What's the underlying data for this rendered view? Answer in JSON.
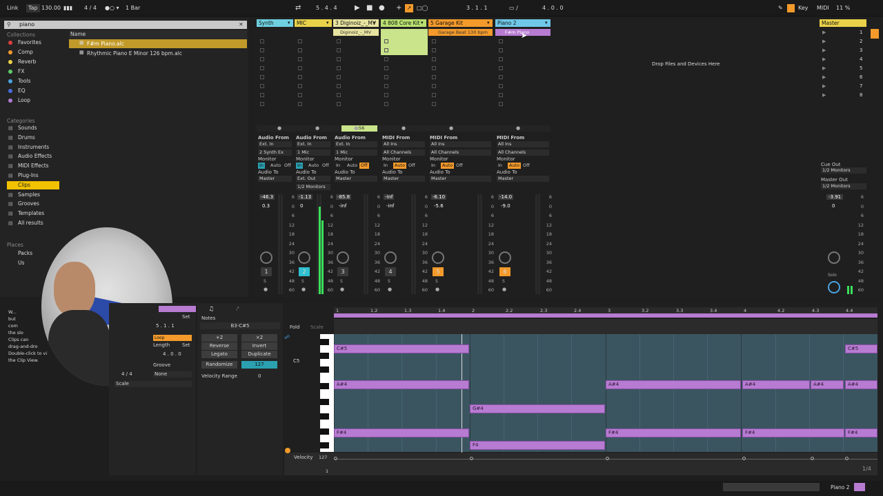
{
  "transport": {
    "link": "Link",
    "tap": "Tap",
    "bpm": "130.00",
    "signature": "4 / 4",
    "quant": "1 Bar",
    "position": "5 . 4 . 4",
    "loop_start": "3 . 1 . 1",
    "loop_len": "4 . 0 . 0",
    "key": "Key",
    "midi": "MIDI",
    "cpu": "11 %"
  },
  "browser": {
    "search_value": "piano",
    "collections_label": "Collections",
    "collections": [
      {
        "label": "Favorites",
        "color": "#e04040"
      },
      {
        "label": "Comp",
        "color": "#f39a2b"
      },
      {
        "label": "Reverb",
        "color": "#e9d24a"
      },
      {
        "label": "FX",
        "color": "#5fc96a"
      },
      {
        "label": "Tools",
        "color": "#4aa3e0"
      },
      {
        "label": "EQ",
        "color": "#4a6ee0"
      },
      {
        "label": "Loop",
        "color": "#b07bd1"
      }
    ],
    "categories_label": "Categories",
    "categories": [
      "Sounds",
      "Drums",
      "Instruments",
      "Audio Effects",
      "MIDI Effects",
      "Plug-Ins",
      "Clips",
      "Samples",
      "Grooves",
      "Templates",
      "All results"
    ],
    "places_label": "Places",
    "places": [
      "Packs",
      "Us",
      "",
      "",
      ""
    ],
    "name_header": "Name",
    "files": [
      "F#m Piano.alc",
      "Rhythmic Piano E Minor 126 bpm.alc"
    ],
    "info_text": [
      "W...",
      "but",
      "com",
      "the slo",
      "Clips can",
      "drag-and-dro",
      "Double-click to vi",
      "the Clip View."
    ]
  },
  "tracks": [
    {
      "name": "Synth",
      "color": "#6fd0e0",
      "from": "Audio From",
      "in": "Ext. In",
      "chan": "2 Synth Ex",
      "to": "Master",
      "vol": "-46.3",
      "pan": "0.3",
      "num": "1",
      "numcolor": "#3a3a3a"
    },
    {
      "name": "MIC",
      "color": "#e9d24a",
      "from": "Audio From",
      "in": "Ext. In",
      "chan": "1 Mic",
      "to": "Ext. Out",
      "to2": "1/2 Monitors",
      "vol": "-1.13",
      "pan": "0",
      "num": "2",
      "numcolor": "#2fbfd0"
    },
    {
      "name": "3 Diginoiz_-_MV",
      "color": "#e8e3a0",
      "from": "Audio From",
      "in": "Ext. In",
      "chan": "1 Mic",
      "to": "Master",
      "vol": "-85.8",
      "pan": "-inf",
      "num": "3",
      "numcolor": "#3a3a3a"
    },
    {
      "name": "4 808 Core Kit",
      "color": "#b8e070",
      "from": "MIDI From",
      "in": "All Ins",
      "chan": "All Channels",
      "to": "Master",
      "vol": "-inf",
      "pan": "-inf",
      "num": "4",
      "numcolor": "#3a3a3a"
    },
    {
      "name": "5 Garage Kit",
      "color": "#f39a2b",
      "from": "MIDI From",
      "in": "All Ins",
      "chan": "All Channels",
      "to": "Master",
      "vol": "-6.10",
      "pan": "-5.6",
      "num": "5",
      "numcolor": "#f39a2b"
    },
    {
      "name": "Piano 2",
      "color": "#70c8e8",
      "from": "MIDI From",
      "in": "All Ins",
      "chan": "All Channels",
      "to": "Master",
      "vol": "-14.0",
      "pan": "-9.0",
      "num": "6",
      "numcolor": "#f39a2b"
    }
  ],
  "clips": {
    "diginoiz": "Diginoiz_-_MV",
    "garage": "Garage Beat 130 bpm",
    "fm_piano": "F#m Piano"
  },
  "audio_from": "Audio From",
  "monitor": "Monitor",
  "audio_to": "Audio To",
  "mon_in": "In",
  "mon_auto": "Auto",
  "mon_off": "Off",
  "drop_text": "Drop Files and Devices Here",
  "master": {
    "name": "Master",
    "cue_out": "Cue Out",
    "cue_val": "1/2 Monitors",
    "master_out": "Master Out",
    "master_val": "1/2 Monitors",
    "vol": "-3.91",
    "pan": "0",
    "solo": "Solo"
  },
  "scenes": [
    "1",
    "2",
    "3",
    "4",
    "5",
    "6",
    "7",
    "8"
  ],
  "meter_scale": [
    "6",
    "0",
    "6",
    "12",
    "18",
    "24",
    "30",
    "36",
    "42",
    "48",
    "60"
  ],
  "clipview": {
    "set1": "Set",
    "set2": "Set",
    "sig": "5 . 1 . 1",
    "length_lbl": "Length",
    "len_val": "4 . 0 . 0",
    "groove": "Groove",
    "none": "None",
    "scale": "Scale",
    "sig2": "4 / 4",
    "loop": "Loop",
    "notes_lbl": "Notes",
    "range": "B3-C#5",
    "fold": "Fold",
    "scale2": "Scale",
    "plus2": "+2",
    "x2": "×2",
    "reverse": "Reverse",
    "invert": "Invert",
    "legato": "Legato",
    "duplicate": "Duplicate",
    "randomize": "Randomize",
    "rand_val": "127",
    "vel_range": "Velocity Range",
    "vel_range_val": "0",
    "velocity": "Velocity",
    "vel_max": "127",
    "vel_min": "1",
    "pitch": "C5",
    "page": "1/4"
  },
  "ruler": [
    "1",
    "1.2",
    "1.3",
    "1.4",
    "2",
    "2.2",
    "2.3",
    "2.4",
    "3",
    "3.2",
    "3.3",
    "3.4",
    "4",
    "4.2",
    "4.3",
    "4.4"
  ],
  "notes": [
    {
      "label": "C#5"
    },
    {
      "label": "C#5"
    },
    {
      "label": "A#4"
    },
    {
      "label": "A#4"
    },
    {
      "label": "A#4"
    },
    {
      "label": "A#4"
    },
    {
      "label": "A#4"
    },
    {
      "label": "G#4"
    },
    {
      "label": "F#4"
    },
    {
      "label": "F#4"
    },
    {
      "label": "F#4"
    },
    {
      "label": "F#4"
    },
    {
      "label": "F4"
    }
  ],
  "status": {
    "track": "Piano 2"
  }
}
